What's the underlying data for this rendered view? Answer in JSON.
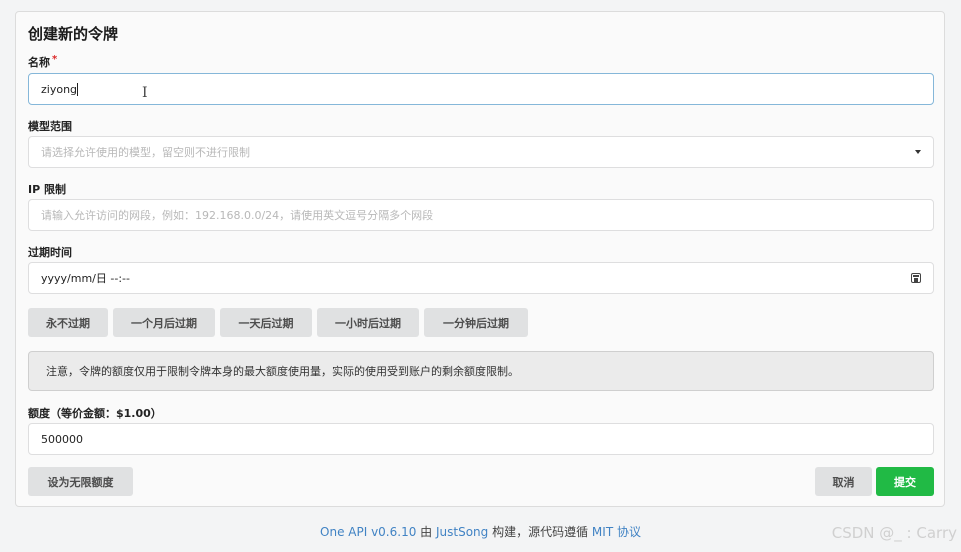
{
  "form": {
    "title": "创建新的令牌",
    "name": {
      "label": "名称",
      "required_mark": "*",
      "value": "ziyong"
    },
    "models": {
      "label": "模型范围",
      "placeholder": "请选择允许使用的模型，留空则不进行限制",
      "icon": "dropdown-arrow"
    },
    "ip": {
      "label": "IP 限制",
      "placeholder": "请输入允许访问的网段，例如：192.168.0.0/24，请使用英文逗号分隔多个网段"
    },
    "expire": {
      "label": "过期时间",
      "value": "yyyy/mm/日 --:--",
      "icon": "calendar-icon",
      "presets": [
        "永不过期",
        "一个月后过期",
        "一天后过期",
        "一小时后过期",
        "一分钟后过期"
      ]
    },
    "notice": "注意，令牌的额度仅用于限制令牌本身的最大额度使用量，实际的使用受到账户的剩余额度限制。",
    "quota": {
      "label": "额度（等价金额：$1.00）",
      "value": "500000"
    },
    "unlimited_button": "设为无限额度",
    "cancel_button": "取消",
    "submit_button": "提交",
    "submit_color": "#21ba45"
  },
  "footer": {
    "product": "One API v0.6.10",
    "by": " 由 ",
    "author": "JustSong",
    "built": " 构建，源代码遵循 ",
    "license": "MIT 协议"
  },
  "watermark": "CSDN @_ : Carry"
}
